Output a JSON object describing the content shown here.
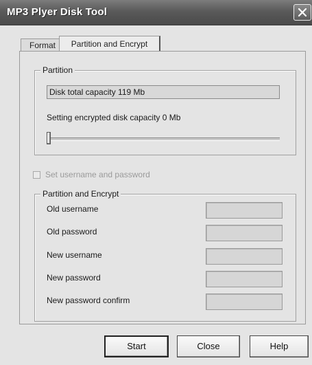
{
  "window": {
    "title": "MP3 Plyer Disk Tool"
  },
  "tabs": [
    {
      "label": "Format"
    },
    {
      "label": "Partition and Encrypt"
    }
  ],
  "partition": {
    "legend": "Partition",
    "capacity_text": "Disk total capacity 119 Mb",
    "encrypted_text": "Setting encrypted disk capacity 0 Mb",
    "slider_value": 0
  },
  "credentials_checkbox": {
    "label": "Set username and password",
    "checked": false,
    "enabled": false
  },
  "encrypt": {
    "legend": "Partition and Encrypt",
    "fields": [
      {
        "label": "Old username",
        "value": ""
      },
      {
        "label": "Old password",
        "value": ""
      },
      {
        "label": "New username",
        "value": ""
      },
      {
        "label": "New password",
        "value": ""
      },
      {
        "label": "New password confirm",
        "value": ""
      }
    ]
  },
  "buttons": {
    "start": "Start",
    "close": "Close",
    "help": "Help"
  },
  "icons": {
    "close": "close-icon"
  }
}
